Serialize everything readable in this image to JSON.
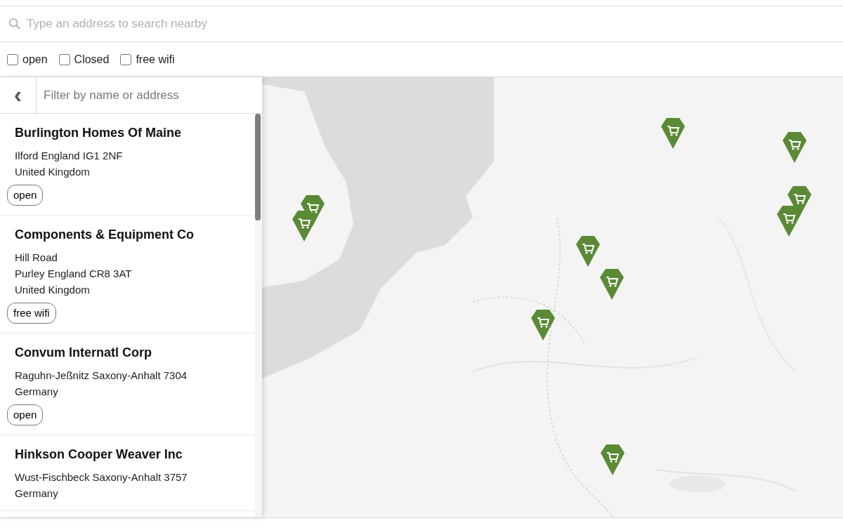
{
  "search": {
    "placeholder": "Type an address to search nearby"
  },
  "filters": [
    {
      "label": "open",
      "checked": false
    },
    {
      "label": "Closed",
      "checked": false
    },
    {
      "label": "free wifi",
      "checked": false
    }
  ],
  "sidebar": {
    "back_icon": "‹",
    "filter": {
      "placeholder": "Filter by name or address"
    },
    "items": [
      {
        "name": "Burlington Homes Of Maine",
        "address": [
          "Ilford England IG1 2NF",
          "United Kingdom"
        ],
        "tag": "open"
      },
      {
        "name": "Components & Equipment Co",
        "address": [
          "Hill Road",
          "Purley England CR8 3AT",
          "United Kingdom"
        ],
        "tag": "free wifi"
      },
      {
        "name": "Convum Internatl Corp",
        "address": [
          "Raguhn-Jeßnitz Saxony-Anhalt 7304",
          "Germany"
        ],
        "tag": "open"
      },
      {
        "name": "Hinkson Cooper Weaver Inc",
        "address": [
          "Wust-Fischbeck Saxony-Anhalt 3757",
          "Germany"
        ]
      }
    ]
  }
}
